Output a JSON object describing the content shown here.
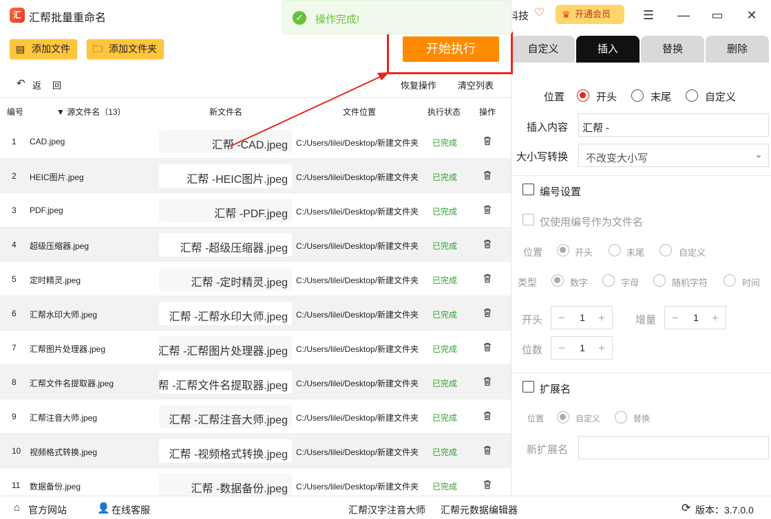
{
  "app": {
    "title": "汇帮批量重命名",
    "brand": "汇帮科技",
    "vip_label": "开通会员"
  },
  "toast": {
    "text": "操作完成!"
  },
  "toolbar": {
    "add_file": "添加文件",
    "add_folder": "添加文件夹",
    "start": "开始执行"
  },
  "tabs": [
    "自定义",
    "插入",
    "替换",
    "删除"
  ],
  "list": {
    "back": "返",
    "back2": "回",
    "restore": "恢复操作",
    "clear": "清空列表",
    "headers": {
      "idx": "编号",
      "src": "▼ 源文件名（13）",
      "new": "新文件名",
      "path": "文件位置",
      "status": "执行状态",
      "op": "操作"
    },
    "rows": [
      {
        "idx": "1",
        "src": "CAD.jpeg",
        "new": "汇帮 -CAD.jpeg",
        "path": "C:/Users/lilei/Desktop/新建文件夹",
        "status": "已完成"
      },
      {
        "idx": "2",
        "src": "HEIC图片.jpeg",
        "new": "汇帮 -HEIC图片.jpeg",
        "path": "C:/Users/lilei/Desktop/新建文件夹",
        "status": "已完成"
      },
      {
        "idx": "3",
        "src": "PDF.jpeg",
        "new": "汇帮 -PDF.jpeg",
        "path": "C:/Users/lilei/Desktop/新建文件夹",
        "status": "已完成"
      },
      {
        "idx": "4",
        "src": "超级压缩器.jpeg",
        "new": "汇帮 -超级压缩器.jpeg",
        "path": "C:/Users/lilei/Desktop/新建文件夹",
        "status": "已完成"
      },
      {
        "idx": "5",
        "src": "定时精灵.jpeg",
        "new": "汇帮 -定时精灵.jpeg",
        "path": "C:/Users/lilei/Desktop/新建文件夹",
        "status": "已完成"
      },
      {
        "idx": "6",
        "src": "汇帮水印大师.jpeg",
        "new": "汇帮 -汇帮水印大师.jpeg",
        "path": "C:/Users/lilei/Desktop/新建文件夹",
        "status": "已完成"
      },
      {
        "idx": "7",
        "src": "汇帮图片处理器.jpeg",
        "new": "汇帮 -汇帮图片处理器.jpeg",
        "path": "C:/Users/lilei/Desktop/新建文件夹",
        "status": "已完成"
      },
      {
        "idx": "8",
        "src": "汇帮文件名提取器.jpeg",
        "new": "汇帮 -汇帮文件名提取器.jpeg",
        "path": "C:/Users/lilei/Desktop/新建文件夹",
        "status": "已完成"
      },
      {
        "idx": "9",
        "src": "汇帮注音大师.jpeg",
        "new": "汇帮 -汇帮注音大师.jpeg",
        "path": "C:/Users/lilei/Desktop/新建文件夹",
        "status": "已完成"
      },
      {
        "idx": "10",
        "src": "视频格式转换.jpeg",
        "new": "汇帮 -视频格式转换.jpeg",
        "path": "C:/Users/lilei/Desktop/新建文件夹",
        "status": "已完成"
      },
      {
        "idx": "11",
        "src": "数据备份.jpeg",
        "new": "汇帮 -数据备份.jpeg",
        "path": "C:/Users/lilei/Desktop/新建文件夹",
        "status": "已完成"
      }
    ]
  },
  "panel": {
    "position_label": "位置",
    "pos_start": "开头",
    "pos_end": "末尾",
    "pos_custom": "自定义",
    "insert_label": "插入内容",
    "insert_value": "汇帮 -",
    "case_label": "大小写转换",
    "case_value": "不改变大小写",
    "numbering": "编号设置",
    "only_number": "仅使用编号作为文件名",
    "num_pos_label": "位置",
    "num_pos_start": "开头",
    "num_pos_end": "末尾",
    "num_pos_custom": "自定义",
    "type_label": "类型",
    "type_digit": "数字",
    "type_letter": "字母",
    "type_random": "随机字符",
    "type_time": "时间",
    "start_label": "开头",
    "start_value": "1",
    "increment_label": "增量",
    "increment_value": "1",
    "digits_label": "位数",
    "digits_value": "1",
    "ext": "扩展名",
    "ext_pos_label": "位置",
    "ext_custom": "自定义",
    "ext_replace": "替换",
    "new_ext_label": "新扩展名",
    "new_ext_value": ""
  },
  "statusbar": {
    "website": "官方网站",
    "service": "在线客服",
    "link1": "汇帮汉字注音大师",
    "link2": "汇帮元数据编辑器",
    "version": "版本：3.7.0.0"
  },
  "colors": {
    "accent": "#ff8a00",
    "highlight": "#e8261c",
    "button": "#ffc53d",
    "success": "#2e9e2e"
  }
}
